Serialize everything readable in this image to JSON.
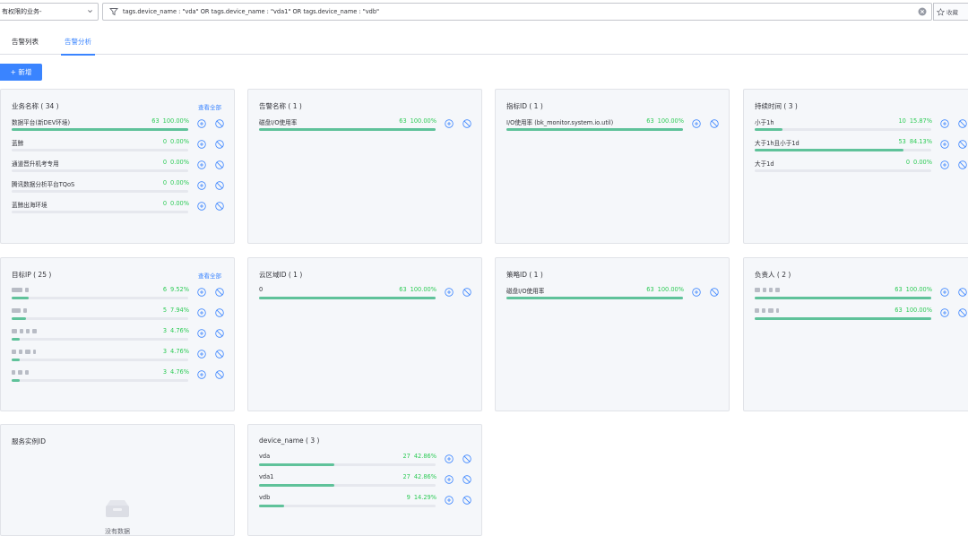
{
  "search": {
    "business_select": "有权限的业务-",
    "query": "tags.device_name : \"vda\" OR tags.device_name : \"vda1\" OR tags.device_name : \"vdb\"",
    "favorite_label": "收藏"
  },
  "tabs": [
    {
      "label": "告警列表",
      "active": false
    },
    {
      "label": "告警分析",
      "active": true
    }
  ],
  "add_button": "+ 新增",
  "view_all": "查看全部",
  "empty_text": "没有数据",
  "colors": {
    "accent": "#3a84ff",
    "bar": "#5fc29a",
    "percent": "#2dcb56"
  },
  "cards": [
    {
      "title": "业务名称 ( 34 )",
      "view_all": true,
      "rows": [
        {
          "label": "数据平台(新DEV环境)",
          "count": "63",
          "percent": "100.00%",
          "ratio": 1.0
        },
        {
          "label": "蓝鲸",
          "count": "0",
          "percent": "0.00%",
          "ratio": 0
        },
        {
          "label": "通道晋升机考专用",
          "count": "0",
          "percent": "0.00%",
          "ratio": 0
        },
        {
          "label": "腾讯数据分析平台TQoS",
          "count": "0",
          "percent": "0.00%",
          "ratio": 0
        },
        {
          "label": "蓝鲸出海环境",
          "count": "0",
          "percent": "0.00%",
          "ratio": 0
        }
      ]
    },
    {
      "title": "告警名称 ( 1 )",
      "view_all": false,
      "rows": [
        {
          "label": "磁盘I/O使用率",
          "count": "63",
          "percent": "100.00%",
          "ratio": 1.0
        }
      ]
    },
    {
      "title": "指标ID ( 1 )",
      "view_all": false,
      "rows": [
        {
          "label": "I/O使用率 (bk_monitor.system.io.util)",
          "count": "63",
          "percent": "100.00%",
          "ratio": 1.0
        }
      ]
    },
    {
      "title": "持续时间 ( 3 )",
      "view_all": false,
      "rows": [
        {
          "label": "小于1h",
          "count": "10",
          "percent": "15.87%",
          "ratio": 0.1587
        },
        {
          "label": "大于1h且小于1d",
          "count": "53",
          "percent": "84.13%",
          "ratio": 0.8413
        },
        {
          "label": "大于1d",
          "count": "0",
          "percent": "0.00%",
          "ratio": 0
        }
      ]
    },
    {
      "title": "目标IP ( 25 )",
      "view_all": true,
      "rows": [
        {
          "label": "",
          "masked": true,
          "count": "6",
          "percent": "9.52%",
          "ratio": 0.0952
        },
        {
          "label": "",
          "masked": true,
          "count": "5",
          "percent": "7.94%",
          "ratio": 0.0794
        },
        {
          "label": "",
          "masked": true,
          "count": "3",
          "percent": "4.76%",
          "ratio": 0.0476
        },
        {
          "label": "",
          "masked": true,
          "count": "3",
          "percent": "4.76%",
          "ratio": 0.0476
        },
        {
          "label": "",
          "masked": true,
          "count": "3",
          "percent": "4.76%",
          "ratio": 0.0476
        }
      ]
    },
    {
      "title": "云区域ID ( 1 )",
      "view_all": false,
      "rows": [
        {
          "label": "0",
          "count": "63",
          "percent": "100.00%",
          "ratio": 1.0
        }
      ]
    },
    {
      "title": "策略ID ( 1 )",
      "view_all": false,
      "rows": [
        {
          "label": "磁盘I/O使用率",
          "count": "63",
          "percent": "100.00%",
          "ratio": 1.0
        }
      ]
    },
    {
      "title": "负责人 ( 2 )",
      "view_all": false,
      "rows": [
        {
          "label": "",
          "masked": true,
          "count": "63",
          "percent": "100.00%",
          "ratio": 1.0
        },
        {
          "label": "",
          "masked": true,
          "count": "63",
          "percent": "100.00%",
          "ratio": 1.0
        }
      ]
    },
    {
      "title": "服务实例ID",
      "view_all": false,
      "empty": true,
      "rows": []
    },
    {
      "title": "device_name ( 3 )",
      "view_all": false,
      "rows": [
        {
          "label": "vda",
          "count": "27",
          "percent": "42.86%",
          "ratio": 0.4286
        },
        {
          "label": "vda1",
          "count": "27",
          "percent": "42.86%",
          "ratio": 0.4286
        },
        {
          "label": "vdb",
          "count": "9",
          "percent": "14.29%",
          "ratio": 0.1429
        }
      ]
    }
  ]
}
